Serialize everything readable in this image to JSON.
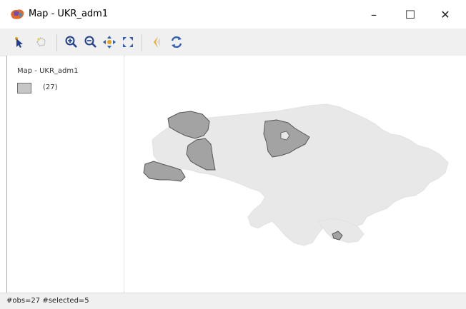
{
  "window": {
    "title": "Map - UKR_adm1",
    "controls": {
      "minimize": "–",
      "maximize": "☐",
      "close": "✕"
    }
  },
  "toolbar": {
    "buttons": [
      {
        "icon": "select-arrow-icon"
      },
      {
        "icon": "select-region-icon"
      },
      {
        "icon": "zoom-in-icon"
      },
      {
        "icon": "zoom-out-icon"
      },
      {
        "icon": "pan-icon"
      },
      {
        "icon": "fit-extent-icon"
      },
      {
        "icon": "classification-icon"
      },
      {
        "icon": "refresh-icon"
      }
    ]
  },
  "legend": {
    "title": "Map - UKR_adm1",
    "items": [
      {
        "count": "(27)",
        "fill": "#c6c6c6"
      }
    ]
  },
  "map": {
    "layer": "UKR_adm1",
    "fill_default": "#e8e8e8",
    "fill_selected": "#a3a3a3",
    "stroke": "#555555"
  },
  "status": {
    "text": "#obs=27 #selected=5"
  }
}
